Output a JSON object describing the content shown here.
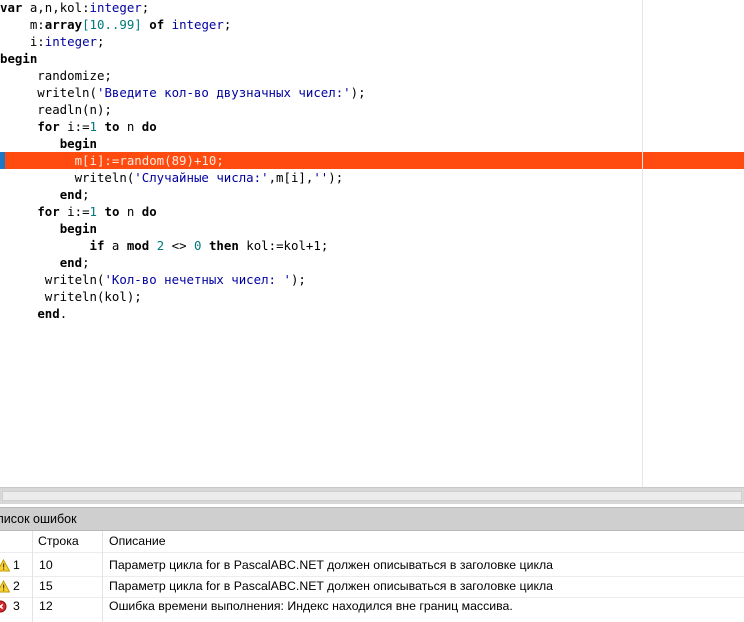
{
  "editor": {
    "highlight_color": "#ff4a10",
    "lines": [
      {
        "parts": [
          {
            "t": "var",
            "c": "kw"
          },
          {
            "t": " a,n,kol:"
          },
          {
            "t": "integer",
            "c": "ty"
          },
          {
            "t": ";"
          }
        ]
      },
      {
        "parts": [
          {
            "t": "    m:"
          },
          {
            "t": "array",
            "c": "kw"
          },
          {
            "t": "[10..99]",
            "c": "num"
          },
          {
            "t": " "
          },
          {
            "t": "of",
            "c": "kw"
          },
          {
            "t": " "
          },
          {
            "t": "integer",
            "c": "ty"
          },
          {
            "t": ";"
          }
        ]
      },
      {
        "parts": [
          {
            "t": "    i:"
          },
          {
            "t": "integer",
            "c": "ty"
          },
          {
            "t": ";"
          }
        ]
      },
      {
        "parts": [
          {
            "t": "begin",
            "c": "kw"
          }
        ]
      },
      {
        "parts": [
          {
            "t": "     randomize;"
          }
        ]
      },
      {
        "parts": [
          {
            "t": "     writeln("
          },
          {
            "t": "'Введите кол-во двузначных чисел:'",
            "c": "str"
          },
          {
            "t": ");"
          }
        ]
      },
      {
        "parts": [
          {
            "t": "     readln(n);"
          }
        ]
      },
      {
        "parts": [
          {
            "t": "     "
          },
          {
            "t": "for",
            "c": "kw"
          },
          {
            "t": " i:="
          },
          {
            "t": "1",
            "c": "num"
          },
          {
            "t": " "
          },
          {
            "t": "to",
            "c": "kw"
          },
          {
            "t": " n "
          },
          {
            "t": "do",
            "c": "kw"
          }
        ]
      },
      {
        "parts": [
          {
            "t": "        "
          },
          {
            "t": "begin",
            "c": "kw"
          }
        ]
      },
      {
        "parts": [
          {
            "t": "          m[i]:=random(89)+10;"
          }
        ],
        "highlight": true
      },
      {
        "parts": [
          {
            "t": "          writeln("
          },
          {
            "t": "'Случайные числа:'",
            "c": "str"
          },
          {
            "t": ",m[i],"
          },
          {
            "t": "''",
            "c": "str"
          },
          {
            "t": ");"
          }
        ]
      },
      {
        "parts": [
          {
            "t": "        "
          },
          {
            "t": "end",
            "c": "kw"
          },
          {
            "t": ";"
          }
        ]
      },
      {
        "parts": [
          {
            "t": "     "
          },
          {
            "t": "for",
            "c": "kw"
          },
          {
            "t": " i:="
          },
          {
            "t": "1",
            "c": "num"
          },
          {
            "t": " "
          },
          {
            "t": "to",
            "c": "kw"
          },
          {
            "t": " n "
          },
          {
            "t": "do",
            "c": "kw"
          }
        ]
      },
      {
        "parts": [
          {
            "t": "        "
          },
          {
            "t": "begin",
            "c": "kw"
          }
        ]
      },
      {
        "parts": [
          {
            "t": "            "
          },
          {
            "t": "if",
            "c": "kw"
          },
          {
            "t": " a "
          },
          {
            "t": "mod",
            "c": "kw"
          },
          {
            "t": " "
          },
          {
            "t": "2",
            "c": "num"
          },
          {
            "t": " <> "
          },
          {
            "t": "0",
            "c": "num"
          },
          {
            "t": " "
          },
          {
            "t": "then",
            "c": "kw"
          },
          {
            "t": " kol:=kol+1;"
          }
        ]
      },
      {
        "parts": [
          {
            "t": "        "
          },
          {
            "t": "end",
            "c": "kw"
          },
          {
            "t": ";"
          }
        ]
      },
      {
        "parts": [
          {
            "t": "      writeln("
          },
          {
            "t": "'Кол-во нечетных чисел: '",
            "c": "str"
          },
          {
            "t": ");"
          }
        ]
      },
      {
        "parts": [
          {
            "t": "      writeln(kol);"
          }
        ]
      },
      {
        "parts": [
          {
            "t": "     "
          },
          {
            "t": "end",
            "c": "kw"
          },
          {
            "t": "."
          }
        ]
      }
    ]
  },
  "error_panel": {
    "title": "писок ошибок",
    "columns": {
      "line": "Строка",
      "description": "Описание"
    },
    "rows": [
      {
        "icon": "warning-icon",
        "num": "1",
        "line": "10",
        "description": "Параметр цикла for в PascalABC.NET должен описываться в заголовке цикла"
      },
      {
        "icon": "warning-icon",
        "num": "2",
        "line": "15",
        "description": "Параметр цикла for в PascalABC.NET должен описываться в заголовке цикла"
      },
      {
        "icon": "error-icon",
        "num": "3",
        "line": "12",
        "description": "Ошибка времени выполнения: Индекс находился вне границ массива."
      }
    ]
  }
}
